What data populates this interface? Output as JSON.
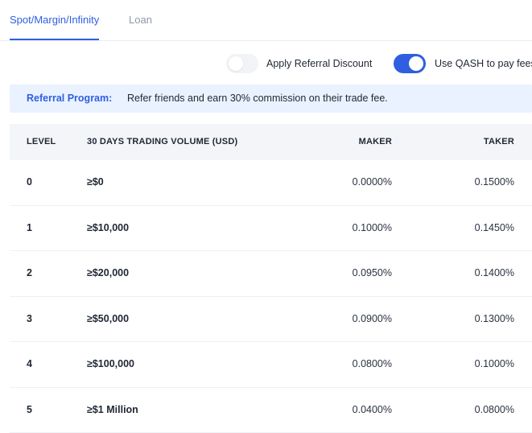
{
  "tabs": {
    "active": "Spot/Margin/Infinity",
    "inactive": "Loan"
  },
  "toggles": {
    "referral": {
      "label": "Apply Referral Discount",
      "on": false
    },
    "qash": {
      "label": "Use QASH to pay fees",
      "on": true
    }
  },
  "banner": {
    "title": "Referral Program:",
    "text": "Refer friends and earn 30% commission on their trade fee."
  },
  "table": {
    "headers": {
      "level": "LEVEL",
      "volume": "30 DAYS TRADING VOLUME (USD)",
      "maker": "MAKER",
      "taker": "TAKER"
    },
    "rows": [
      {
        "level": "0",
        "volume": "≥$0",
        "maker": "0.0000%",
        "taker": "0.1500%"
      },
      {
        "level": "1",
        "volume": "≥$10,000",
        "maker": "0.1000%",
        "taker": "0.1450%"
      },
      {
        "level": "2",
        "volume": "≥$20,000",
        "maker": "0.0950%",
        "taker": "0.1400%"
      },
      {
        "level": "3",
        "volume": "≥$50,000",
        "maker": "0.0900%",
        "taker": "0.1300%"
      },
      {
        "level": "4",
        "volume": "≥$100,000",
        "maker": "0.0800%",
        "taker": "0.1000%"
      },
      {
        "level": "5",
        "volume": "≥$1 Million",
        "maker": "0.0400%",
        "taker": "0.0800%"
      }
    ]
  },
  "colors": {
    "accent": "#2f5fe0",
    "banner_bg": "#eaf2ff",
    "header_bg": "#f3f5f8"
  }
}
